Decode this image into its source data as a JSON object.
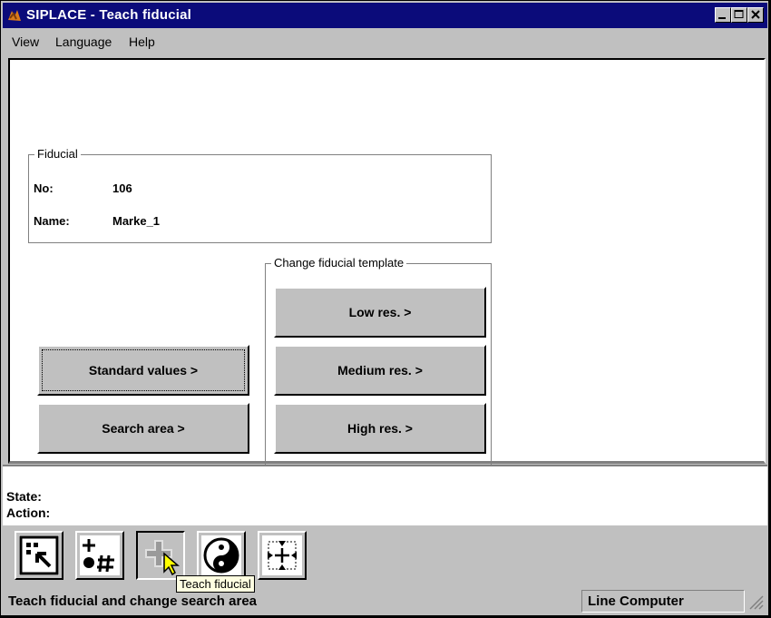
{
  "window": {
    "title": "SIPLACE - Teach fiducial"
  },
  "menu": [
    "View",
    "Language",
    "Help"
  ],
  "fiducial": {
    "group_label": "Fiducial",
    "no_label": "No:",
    "no_value": "106",
    "name_label": "Name:",
    "name_value": "Marke_1"
  },
  "template": {
    "group_label": "Change fiducial template",
    "low": "Low res. >",
    "medium": "Medium res. >",
    "high": "High res. >"
  },
  "buttons": {
    "standard": "Standard values >",
    "search": "Search area >"
  },
  "info": {
    "state_label": "State:",
    "action_label": "Action:"
  },
  "toolbar": {
    "tooltip": "Teach fiducial"
  },
  "statusbar": {
    "message": "Teach fiducial and change search area",
    "right": "Line Computer"
  }
}
